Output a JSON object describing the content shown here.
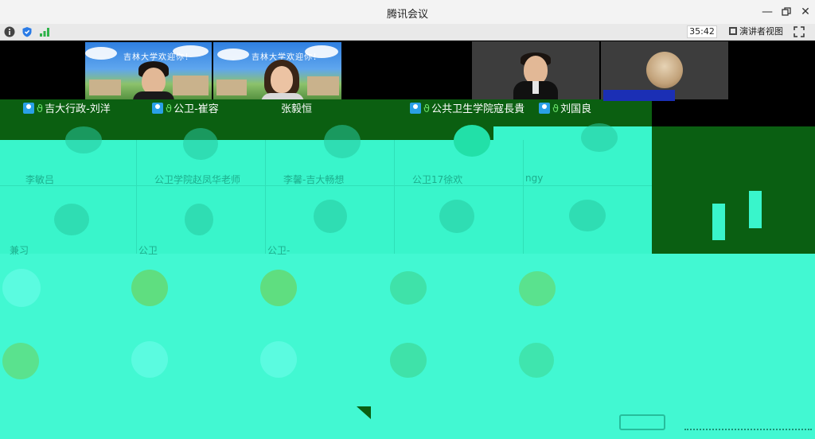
{
  "window": {
    "title": "腾讯会议"
  },
  "toolbar": {
    "timer": "35:42",
    "speaker_view_label": "演讲者视图"
  },
  "participants": [
    {
      "name": "吉大行政-刘洋"
    },
    {
      "name": "公卫-崔容"
    },
    {
      "name": "张毅恒"
    },
    {
      "name": "公共卫生学院寇長貴"
    },
    {
      "name": "刘国良"
    }
  ],
  "campus_banner": "吉林大学欢迎你！",
  "glitch_labels": [
    "李敏吕",
    "公卫学院赵凤华老师",
    "李馨-吉大畅想",
    "公卫17徐欢",
    "ngy",
    "兼习",
    "公卫",
    "公卫-"
  ],
  "colors": {
    "accent_blue": "#2aa0e6",
    "mic_green": "#6ae06a",
    "glitch_cyan": "#39f5cb",
    "glitch_green": "#0b5f11"
  }
}
